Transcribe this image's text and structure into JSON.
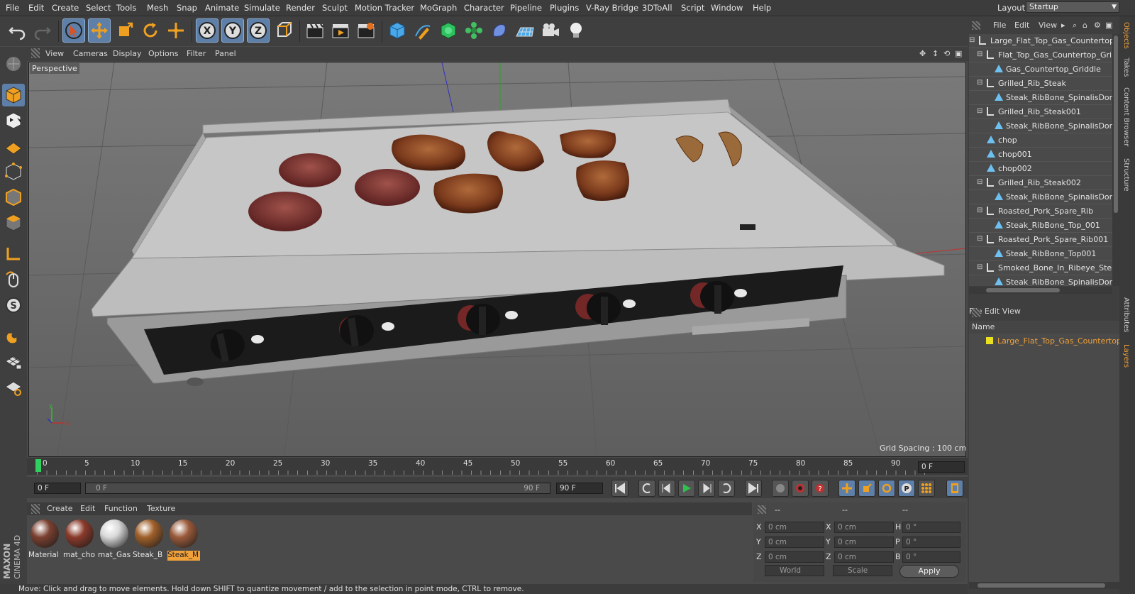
{
  "menubar": {
    "items": [
      "File",
      "Edit",
      "Create",
      "Select",
      "Tools",
      "Mesh",
      "Snap",
      "Animate",
      "Simulate",
      "Render",
      "Sculpt",
      "Motion Tracker",
      "MoGraph",
      "Character",
      "Pipeline",
      "Plugins",
      "V-Ray Bridge",
      "3DToAll",
      "Script",
      "Window",
      "Help"
    ],
    "layout_label": "Layout:",
    "layout_value": "Startup"
  },
  "viewport": {
    "menu": [
      "View",
      "Cameras",
      "Display",
      "Options",
      "Filter",
      "Panel"
    ],
    "camera_label": "Perspective",
    "grid_spacing": "Grid Spacing : 100 cm"
  },
  "timeline": {
    "ticks": [
      "0",
      "5",
      "10",
      "15",
      "20",
      "25",
      "30",
      "35",
      "40",
      "45",
      "50",
      "55",
      "60",
      "65",
      "70",
      "75",
      "80",
      "85",
      "90"
    ],
    "frame_right": "0 F",
    "start_field": "0 F",
    "range_start": "0 F",
    "range_end": "90 F",
    "end_field": "90 F"
  },
  "materials": {
    "menu": [
      "Create",
      "Edit",
      "Function",
      "Texture"
    ],
    "items": [
      {
        "label": "Material",
        "color": "#7a4030"
      },
      {
        "label": "mat_cho",
        "color": "#8a3a2a"
      },
      {
        "label": "mat_Gas",
        "color": "#d8d8d8"
      },
      {
        "label": "Steak_B",
        "color": "#a0602a"
      },
      {
        "label": "Steak_M",
        "color": "#9a5a3a"
      }
    ]
  },
  "coordinates": {
    "header": [
      "--",
      "--",
      "--"
    ],
    "rows": [
      {
        "a": "X",
        "av": "0 cm",
        "b": "X",
        "bv": "0 cm",
        "c": "H",
        "cv": "0 °"
      },
      {
        "a": "Y",
        "av": "0 cm",
        "b": "Y",
        "bv": "0 cm",
        "c": "P",
        "cv": "0 °"
      },
      {
        "a": "Z",
        "av": "0 cm",
        "b": "Z",
        "bv": "0 cm",
        "c": "B",
        "cv": "0 °"
      }
    ],
    "space": "World",
    "mode": "Scale",
    "apply": "Apply"
  },
  "status": "Move: Click and drag to move elements. Hold down SHIFT to quantize movement / add to the selection in point mode, CTRL to remove.",
  "objects": {
    "menu": [
      "File",
      "Edit",
      "View"
    ],
    "rows": [
      {
        "label": "Large_Flat_Top_Gas_Countertop",
        "indent": 0,
        "type": "null"
      },
      {
        "label": "Flat_Top_Gas_Countertop_Gri",
        "indent": 1,
        "type": "null"
      },
      {
        "label": "Gas_Countertop_Griddle",
        "indent": 2,
        "type": "poly"
      },
      {
        "label": "Grilled_Rib_Steak",
        "indent": 1,
        "type": "null"
      },
      {
        "label": "Steak_RibBone_SpinalisDors",
        "indent": 2,
        "type": "poly"
      },
      {
        "label": "Grilled_Rib_Steak001",
        "indent": 1,
        "type": "null"
      },
      {
        "label": "Steak_RibBone_SpinalisDors",
        "indent": 2,
        "type": "poly"
      },
      {
        "label": "chop",
        "indent": 1,
        "type": "poly"
      },
      {
        "label": "chop001",
        "indent": 1,
        "type": "poly"
      },
      {
        "label": "chop002",
        "indent": 1,
        "type": "poly"
      },
      {
        "label": "Grilled_Rib_Steak002",
        "indent": 1,
        "type": "null"
      },
      {
        "label": "Steak_RibBone_SpinalisDors",
        "indent": 2,
        "type": "poly"
      },
      {
        "label": "Roasted_Pork_Spare_Rib",
        "indent": 1,
        "type": "null"
      },
      {
        "label": "Steak_RibBone_Top_001",
        "indent": 2,
        "type": "poly"
      },
      {
        "label": "Roasted_Pork_Spare_Rib001",
        "indent": 1,
        "type": "null"
      },
      {
        "label": "Steak_RibBone_Top001",
        "indent": 2,
        "type": "poly"
      },
      {
        "label": "Smoked_Bone_In_Ribeye_Stea",
        "indent": 1,
        "type": "null"
      },
      {
        "label": "Steak_RibBone_SpinalisDors",
        "indent": 2,
        "type": "poly"
      }
    ]
  },
  "side_tabs": [
    "Objects",
    "Takes",
    "Content Browser",
    "Structure",
    "Attributes",
    "Layers"
  ],
  "layers": {
    "menu": [
      "File",
      "Edit",
      "View"
    ],
    "header": "Name",
    "row": "Large_Flat_Top_Gas_Countertop_G"
  },
  "colors": {
    "accent": "#f0a13a",
    "selected_tool": "#5e7fa8",
    "poly_icon": "#6ec0f0"
  }
}
